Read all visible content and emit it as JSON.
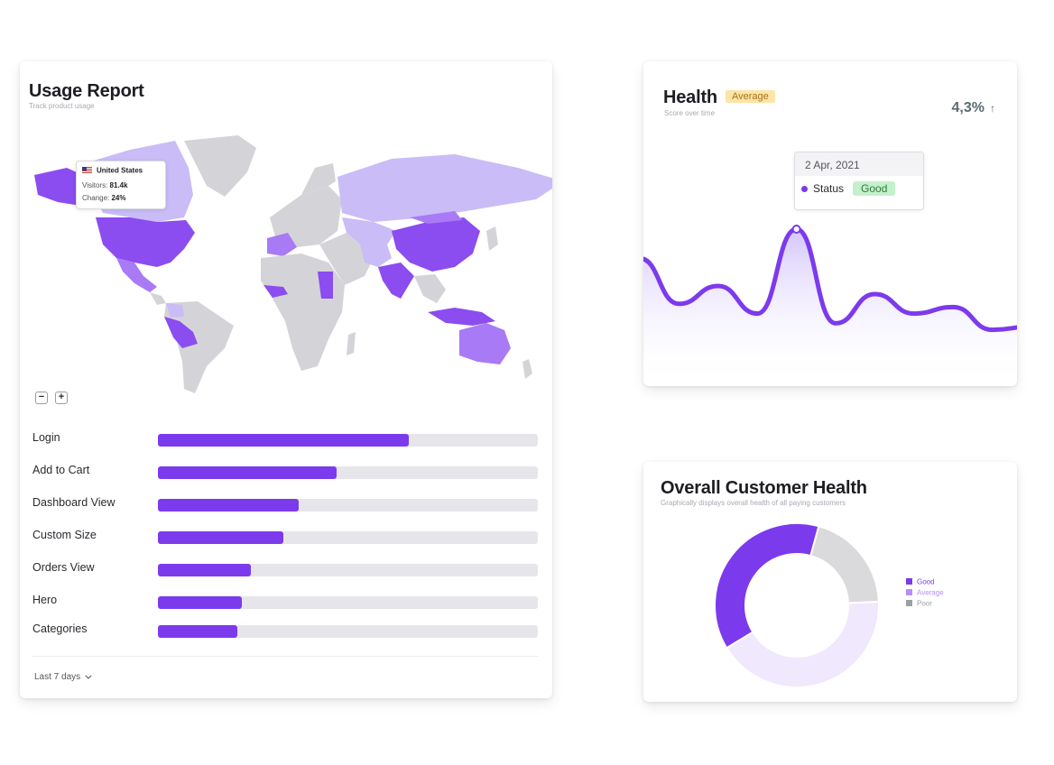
{
  "usage_report": {
    "title": "Usage Report",
    "subtitle": "Track product usage",
    "map_tooltip": {
      "country": "United States",
      "visitors_label": "Visitors:",
      "visitors_value": "81.4k",
      "change_label": "Change:",
      "change_value": "24%"
    },
    "zoom_out": "−",
    "zoom_in": "+",
    "bars": [
      {
        "label": "Login",
        "percent": 66
      },
      {
        "label": "Add to Cart",
        "percent": 47
      },
      {
        "label": "Dashboard View",
        "percent": 37
      },
      {
        "label": "Custom Size",
        "percent": 33
      },
      {
        "label": "Orders View",
        "percent": 24.5
      },
      {
        "label": "Hero",
        "percent": 22
      },
      {
        "label": "Categories",
        "percent": 21
      }
    ],
    "period": "Last 7 days",
    "colors": {
      "bar": "#7c3aed",
      "track": "#e6e6ea",
      "map_dark": "#8b4cf0",
      "map_mid": "#a97af5",
      "map_light": "#c9bcf7",
      "map_neutral": "#d4d4d8"
    }
  },
  "health": {
    "title": "Health",
    "badge": "Average",
    "subtitle": "Score over time",
    "trend_value": "4,3%",
    "trend_arrow": "↑",
    "tooltip": {
      "date": "2 Apr, 2021",
      "status_label": "Status",
      "status_value": "Good"
    },
    "colors": {
      "line": "#7c3aed",
      "badge_bg": "#fde5a8",
      "good_bg": "#c5f0cc"
    }
  },
  "overall": {
    "title": "Overall Customer Health",
    "subtitle": "Graphically displays overall health of all paying customers",
    "legend": [
      {
        "label": "Good",
        "color": "#7c3aed"
      },
      {
        "label": "Average",
        "color": "#b68ef5"
      },
      {
        "label": "Poor",
        "color": "#9e9ea5"
      }
    ]
  },
  "chart_data": [
    {
      "type": "bar",
      "categories": [
        "Login",
        "Add to Cart",
        "Dashboard View",
        "Custom Size",
        "Orders View",
        "Hero",
        "Categories"
      ],
      "values": [
        66,
        47,
        37,
        33,
        24.5,
        22,
        21
      ],
      "ylim": [
        0,
        100
      ]
    },
    {
      "type": "area",
      "x": [
        0,
        1,
        2,
        3,
        4,
        5,
        6,
        7,
        8,
        9,
        10
      ],
      "values": [
        62,
        34,
        45,
        28,
        80,
        22,
        40,
        28,
        32,
        18,
        20
      ],
      "ylim": [
        0,
        100
      ],
      "grid": false
    },
    {
      "type": "pie",
      "categories": [
        "Good",
        "Average",
        "Poor"
      ],
      "values": [
        38,
        42,
        20
      ],
      "colors": [
        "#7c3aed",
        "#f0e8fd",
        "#dadadd"
      ]
    }
  ]
}
